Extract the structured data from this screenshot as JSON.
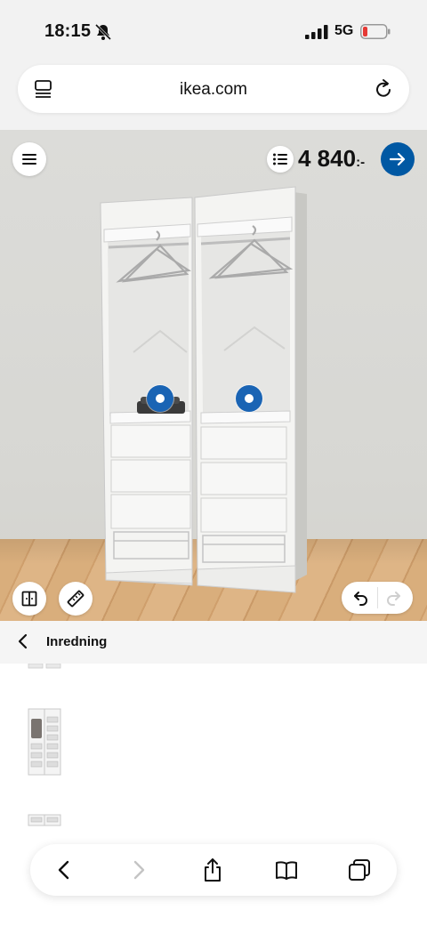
{
  "status_bar": {
    "time": "18:15",
    "network": "5G",
    "icons": [
      "bell-slash-icon",
      "signal-icon",
      "battery-icon"
    ]
  },
  "browser": {
    "domain": "ikea.com",
    "icons": [
      "reader-icon",
      "reload-icon"
    ]
  },
  "planner": {
    "price_amount": "4 840",
    "price_currency": ":-",
    "accent_color": "#0058a3",
    "hotspot_color": "#1a64b4",
    "icons": [
      "menu-icon",
      "list-icon",
      "arrow-right-icon",
      "split-view-icon",
      "ruler-icon",
      "undo-icon",
      "redo-icon"
    ]
  },
  "panel": {
    "title": "Inredning",
    "icons": [
      "chevron-left-icon"
    ]
  },
  "toolbar": {
    "icons": [
      "back-icon",
      "forward-icon",
      "share-icon",
      "bookmarks-icon",
      "tabs-icon"
    ]
  }
}
